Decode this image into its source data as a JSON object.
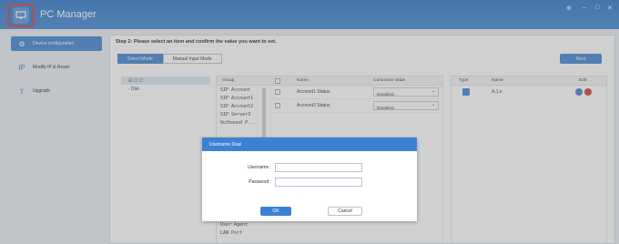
{
  "app": {
    "title": "PC Manager",
    "controls": [
      "⊕",
      "–",
      "□",
      "✕"
    ]
  },
  "sidebar": {
    "items": [
      {
        "label": "Device configuration",
        "icon": "settings-icon",
        "glyph": "⚙"
      },
      {
        "label": "Modify IP & Reset",
        "icon": "ip-icon",
        "glyph": "IP"
      },
      {
        "label": "Upgrade",
        "icon": "upgrade-icon",
        "glyph": "⇧"
      }
    ]
  },
  "main": {
    "step": "Step 2: Please select an item and confirm the value you want to set.",
    "tabs": [
      "Select Mode",
      "Manual Input Mode"
    ],
    "next_label": "Next",
    "tree": [
      "☑ ☐ ☐",
      "· Dist"
    ],
    "grid": {
      "headers": {
        "group": "Group",
        "name": "Name",
        "value": "Commons Value"
      },
      "groups": [
        "SIP Account",
        "SIP Account1",
        "SIP Account2",
        "SIP Server3",
        "Outbound P..."
      ],
      "groups_bottom": [
        "User Agent",
        "LAN Port"
      ],
      "rows": [
        {
          "name": "Account1 Status",
          "value": "Disabled"
        },
        {
          "name": "Account2 Status",
          "value": "Disabled"
        }
      ]
    },
    "right": {
      "headers": {
        "type": "Type",
        "name": "Name",
        "edit": "Edit"
      },
      "rows": [
        {
          "name": "A.1.e"
        }
      ]
    }
  },
  "dialog": {
    "title": "Username Dual",
    "username_label": "Username  :",
    "password_label": "Password  :",
    "ok_label": "OK",
    "cancel_label": "Cancel"
  }
}
